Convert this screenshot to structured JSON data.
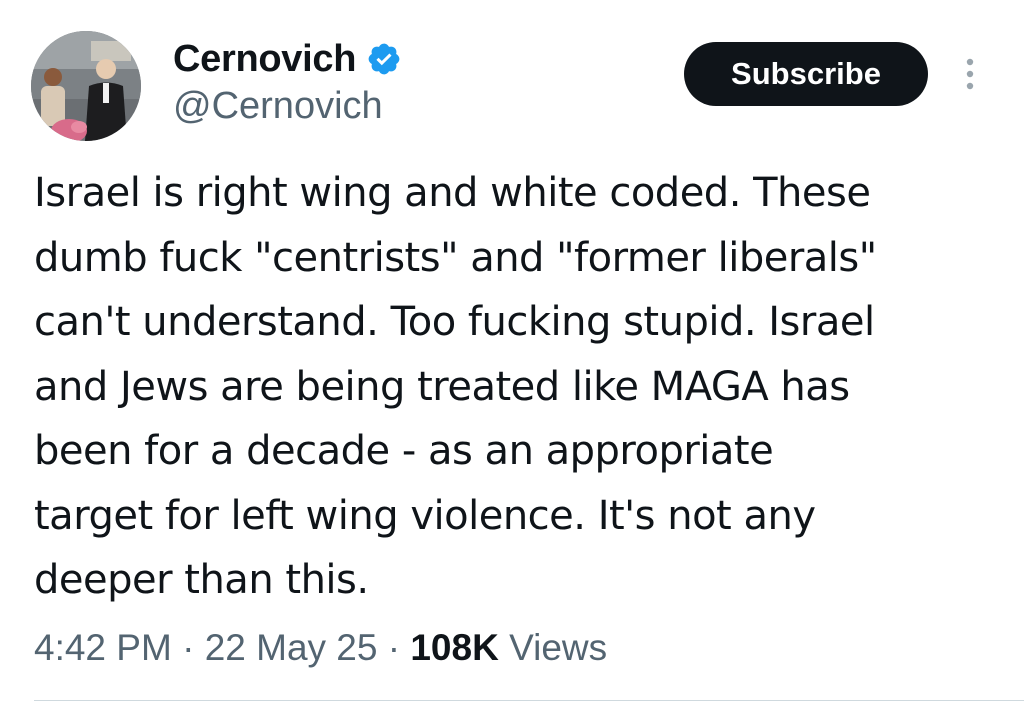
{
  "author": {
    "display_name": "Cernovich",
    "handle": "@Cernovich",
    "verified": true,
    "verified_color": "#1d9bf0"
  },
  "actions": {
    "subscribe_label": "Subscribe",
    "more_icon": "more-vertical-icon"
  },
  "tweet": {
    "text": "Israel is right wing and white coded. These\ndumb fuck \"centrists\" and \"former liberals\"\ncan't understand. Too fucking stupid. Israel\nand Jews are being treated like MAGA has\nbeen for a decade - as an appropriate\ntarget for left wing violence. It's not any\ndeeper than this.",
    "time": "4:42 PM",
    "date": "22 May 25",
    "views_count": "108K",
    "views_label": "Views"
  },
  "colors": {
    "text_primary": "#0f1419",
    "text_secondary": "#536471",
    "button_bg": "#0f1419",
    "button_text": "#ffffff"
  }
}
